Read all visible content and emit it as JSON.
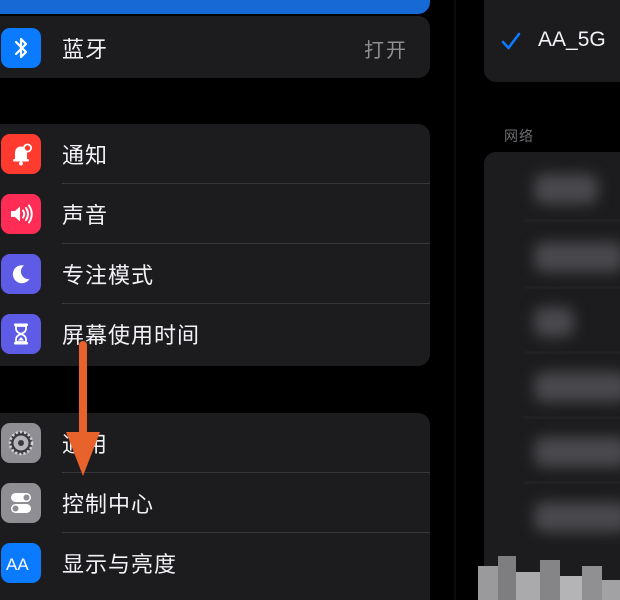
{
  "settings": {
    "connectivity": [
      {
        "label": "蓝牙",
        "value": "打开",
        "icon": "bluetooth-icon",
        "color": "#0a7aff"
      }
    ],
    "notifications": [
      {
        "label": "通知",
        "icon": "notification-bell-icon",
        "color": "#ff3b30"
      },
      {
        "label": "声音",
        "icon": "speaker-icon",
        "color": "#ff2d55"
      },
      {
        "label": "专注模式",
        "icon": "moon-icon",
        "color": "#5e5ce6"
      },
      {
        "label": "屏幕使用时间",
        "icon": "hourglass-icon",
        "color": "#5e5ce6"
      }
    ],
    "general": [
      {
        "label": "通用",
        "icon": "gear-icon",
        "color": "#8e8e93"
      },
      {
        "label": "控制中心",
        "icon": "toggles-icon",
        "color": "#8e8e93"
      },
      {
        "label": "显示与亮度",
        "icon": "display-aa-icon",
        "color": "#0a7aff"
      }
    ]
  },
  "wifi": {
    "connected_network": "AA_5G",
    "networks_section_title": "网络"
  },
  "colors": {
    "accent": "#0a7aff",
    "selected_row": "#1769d6",
    "annotation_arrow": "#e8622b"
  }
}
